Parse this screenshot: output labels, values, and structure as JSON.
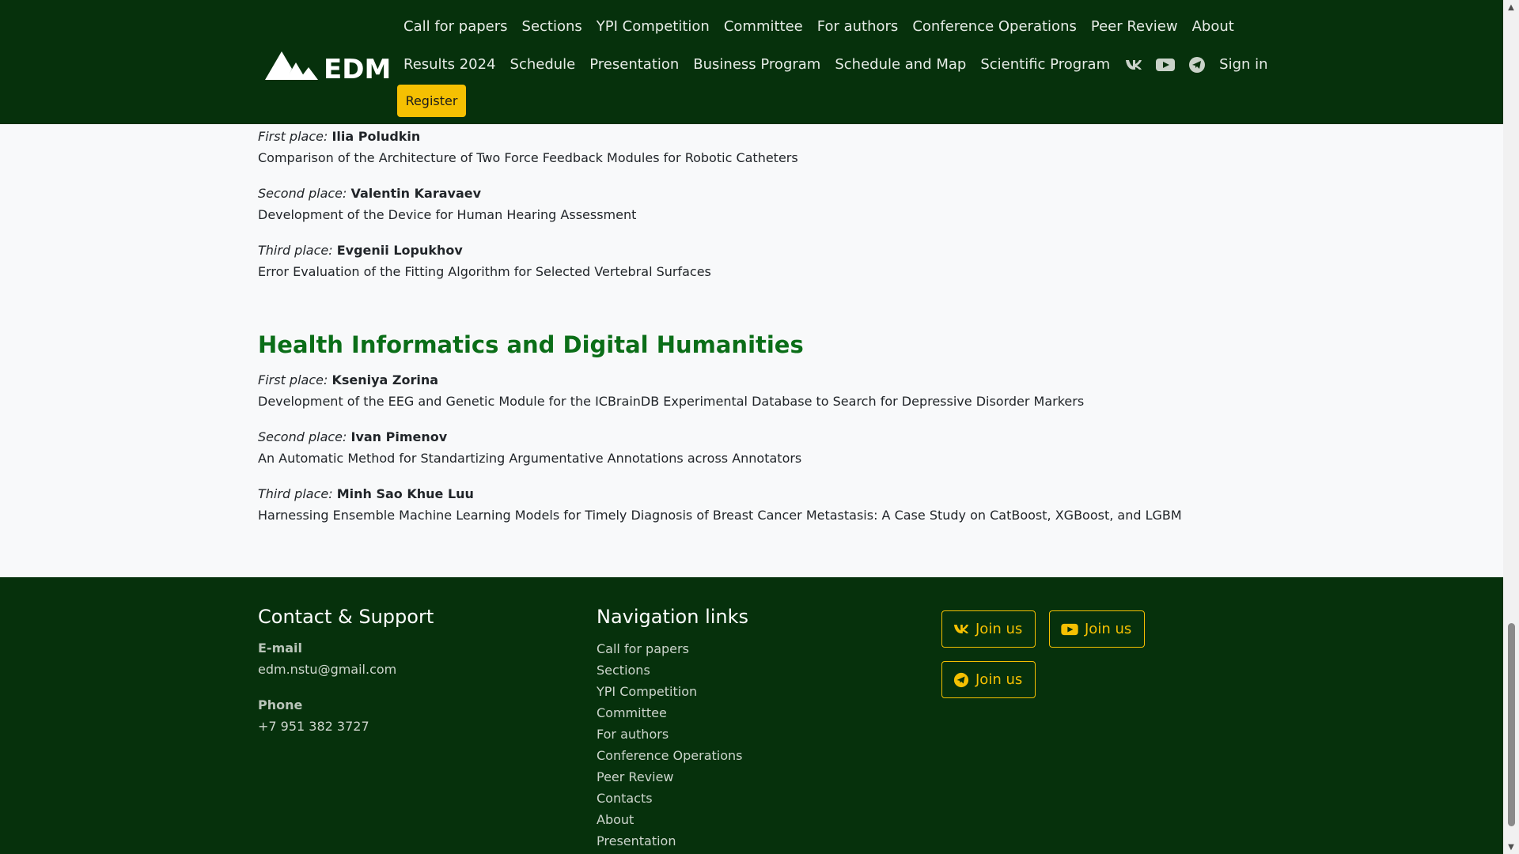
{
  "header": {
    "logo_text": "EDM",
    "nav_row1": [
      "Call for papers",
      "Sections",
      "YPI Competition",
      "Committee",
      "For authors",
      "Conference Operations",
      "Peer Review",
      "About"
    ],
    "nav_row2": [
      "Results 2024",
      "Schedule",
      "Presentation",
      "Business Program",
      "Schedule and Map",
      "Scientific Program"
    ],
    "sign_in": "Sign in",
    "register_label": "Register",
    "icons": [
      "vk-icon",
      "youtube-icon",
      "telegram-icon"
    ]
  },
  "results": {
    "first_block": [
      {
        "label": "First place:",
        "name": "Ilia Poludkin",
        "title": "Comparison of the Architecture of Two Force Feedback Modules for Robotic Catheters"
      },
      {
        "label": "Second place:",
        "name": "Valentin Karavaev",
        "title": "Development of the Device for Human Hearing Assessment"
      },
      {
        "label": "Third place:",
        "name": "Evgenii Lopukhov",
        "title": "Error Evaluation of the Fitting Algorithm for Selected Vertebral Surfaces"
      }
    ],
    "section_heading": "Health Informatics and Digital Humanities",
    "second_block": [
      {
        "label": "First place:",
        "name": "Kseniya Zorina",
        "title": "Development of the EEG and Genetic Module for the ICBrainDB Experimental Database to Search for Depressive Disorder Markers"
      },
      {
        "label": "Second place:",
        "name": "Ivan Pimenov",
        "title": "An Automatic Method for Standartizing Argumentative Annotations across Annotators"
      },
      {
        "label": "Third place:",
        "name": "Minh Sao Khue Luu",
        "title": "Harnessing Ensemble Machine Learning Models for Timely Diagnosis of Breast Cancer Metastasis: A Case Study on CatBoost, XGBoost, and LGBM"
      }
    ]
  },
  "footer": {
    "contact_heading": "Contact & Support",
    "email_label": "E-mail",
    "email_value": "edm.nstu@gmail.com",
    "phone_label": "Phone",
    "phone_value": "+7 951 382 3727",
    "nav_heading": "Navigation links",
    "nav_links": [
      "Call for papers",
      "Sections",
      "YPI Competition",
      "Committee",
      "For authors",
      "Conference Operations",
      "Peer Review",
      "Contacts",
      "About",
      "Presentation"
    ],
    "join_label": "Join us"
  },
  "colors": {
    "header_bg": "#06310c",
    "accent_yellow": "#f5c002",
    "heading_green": "#0b6e18"
  }
}
